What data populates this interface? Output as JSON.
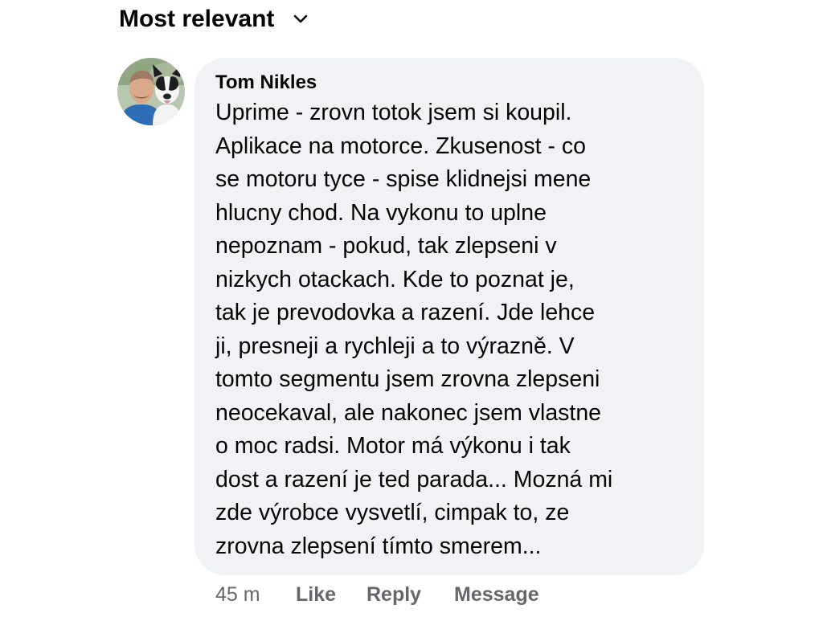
{
  "sort": {
    "label": "Most relevant",
    "icon": "chevron-down-icon"
  },
  "comment": {
    "author": "Tom Nikles",
    "avatar_icon": "avatar-photo",
    "text": "Uprime - zrovn totok jsem si koupil.\nAplikace na motorce. Zkusenost - co\nse motoru tyce - spise klidnejsi mene\nhlucny chod. Na vykonu to uplne\nnepoznam - pokud, tak zlepseni v\nnizkych otackach. Kde to poznat je,\ntak je prevodovka a razení. Jde lehce\nji, presneji a rychleji a to výrazně. V\ntomto segmentu jsem zrovna zlepseni\nneocekaval, ale nakonec jsem vlastne\no moc radsi. Motor má výkonu i tak\ndost a razení je ted parada... Mozná mi\nzde výrobce vysvetlí, cimpak to, ze\nzrovna zlepsení tímto smerem...",
    "timestamp": "45 m",
    "actions": {
      "like": "Like",
      "reply": "Reply",
      "message": "Message"
    }
  },
  "colors": {
    "text_primary": "#050505",
    "text_secondary": "#65676b",
    "bubble_background": "#f0f2f5"
  }
}
